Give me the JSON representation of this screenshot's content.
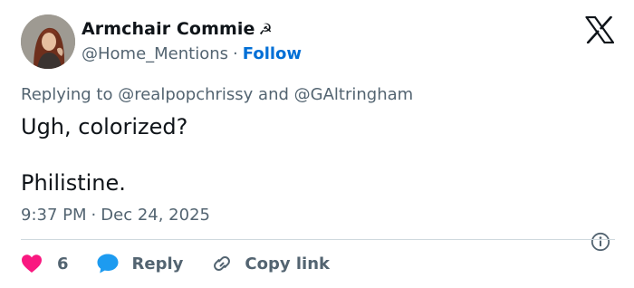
{
  "author": {
    "display_name": "Armchair Commie",
    "name_symbol": "☭",
    "handle": "@Home_Mentions",
    "separator": "·",
    "follow_label": "Follow"
  },
  "reply_context": {
    "prefix": "Replying to",
    "mention_1": "@realpopchrissy",
    "conjunction": "and",
    "mention_2": "@GAltringham"
  },
  "tweet": {
    "line_1": "Ugh, colorized?",
    "line_2": "Philistine."
  },
  "meta": {
    "time": "9:37 PM",
    "separator": "·",
    "date": "Dec 24, 2025"
  },
  "actions": {
    "like_count": "6",
    "reply_label": "Reply",
    "copy_label": "Copy link"
  },
  "icons": {
    "logo": "x-logo-icon",
    "info": "info-icon",
    "like": "heart-icon",
    "reply": "speech-bubble-icon",
    "copy": "link-icon"
  },
  "colors": {
    "text_primary": "#0f1419",
    "text_secondary": "#536471",
    "follow": "#006fd6",
    "like": "#f91880",
    "reply": "#1d9bf0",
    "divider": "#cfd9de"
  }
}
